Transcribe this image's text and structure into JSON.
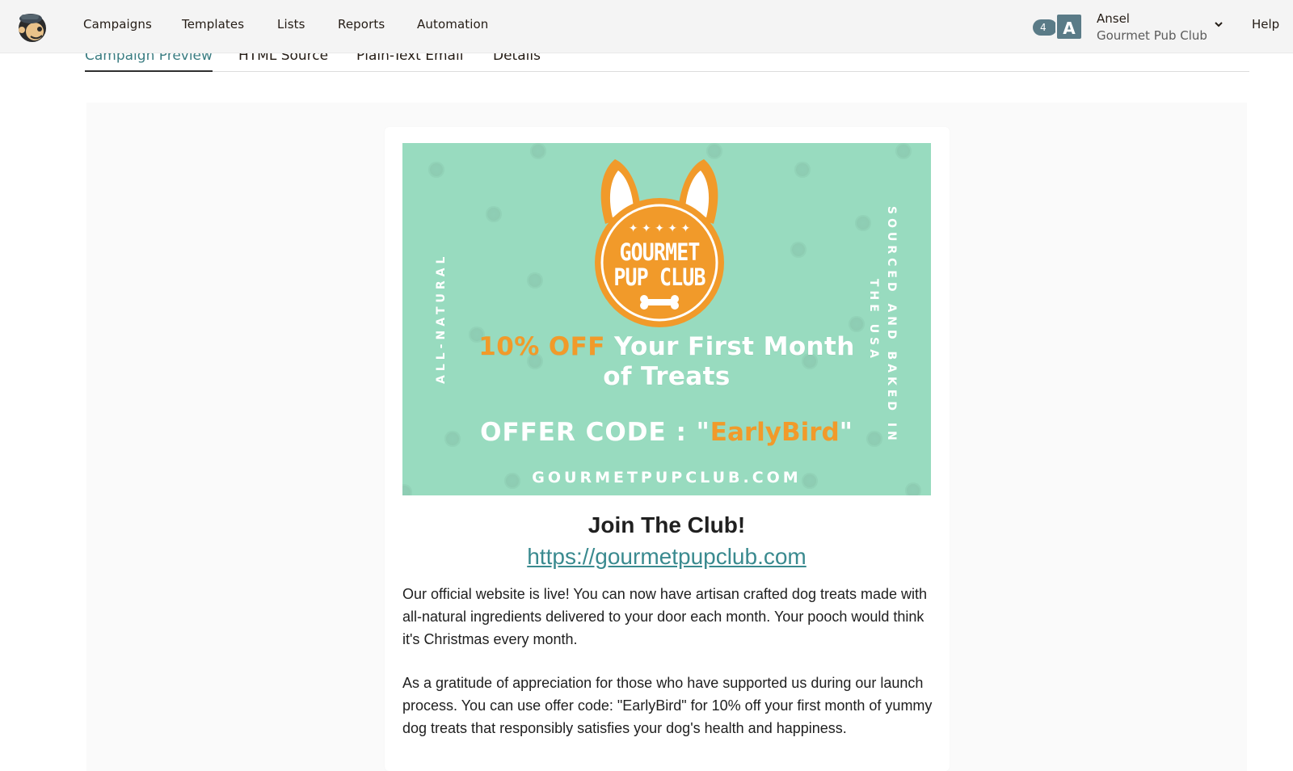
{
  "nav": {
    "items": [
      "Campaigns",
      "Templates",
      "Lists",
      "Reports",
      "Automation"
    ],
    "account_count": "4",
    "account_initial": "A",
    "user_name": "Ansel",
    "user_org": "Gourmet Pub Club",
    "help": "Help"
  },
  "tabs": [
    "Campaign Preview",
    "HTML Source",
    "Plain-Text Email",
    "Details"
  ],
  "banner": {
    "badge_line1": "GOURMET",
    "badge_line2": "PUP CLUB",
    "left_text": "ALL-NATURAL",
    "right_line1": "SOURCED AND BAKED IN",
    "right_line2": "THE USA",
    "offer_highlight": "10% OFF",
    "offer_line1_rest": " Your First Month",
    "offer_line2": "of Treats",
    "code_prefix": "OFFER CODE : \"",
    "code_value": "EarlyBird",
    "code_suffix": "\"",
    "site": "GOURMETPUPCLUB.COM"
  },
  "email": {
    "headline": "Join The Club!",
    "link": "https://gourmetpupclub.com",
    "p1": "Our official website is live! You can now have artisan crafted dog treats made with all-natural ingredients delivered to your door each month. Your pooch would think it's Christmas every month.",
    "p2": "As a gratitude of appreciation for those who have supported us during our launch process. You can use offer code: \"EarlyBird\" for 10% off your first month of yummy dog treats that responsibly satisfies your dog's health and happiness."
  },
  "colors": {
    "banner_bg": "#98dbbf",
    "accent_orange": "#f19a2a",
    "link_teal": "#3a8a8f",
    "active_tab": "#3b7d82",
    "avatar": "#5a7b87"
  },
  "icons": {
    "logo": "mailchimp-freddie-icon",
    "chevron": "chevron-down-icon"
  }
}
